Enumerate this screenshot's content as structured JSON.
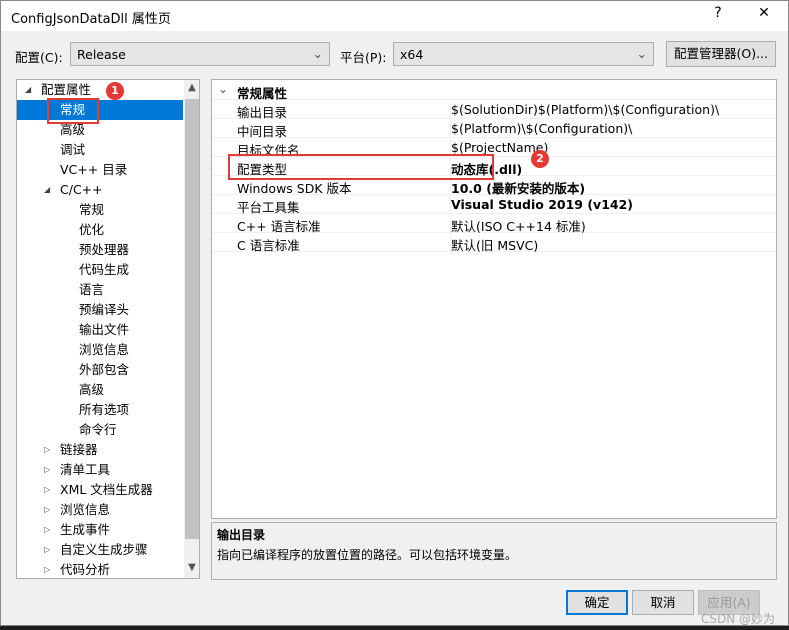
{
  "window": {
    "title": "ConfigJsonDataDll 属性页",
    "help": "?",
    "close": "✕"
  },
  "toolbar": {
    "config_label": "配置(C):",
    "config_value": "Release",
    "platform_label": "平台(P):",
    "platform_value": "x64",
    "manager_button": "配置管理器(O)..."
  },
  "tree": {
    "items": [
      {
        "label": "配置属性",
        "level": 0,
        "expanded": true
      },
      {
        "label": "常规",
        "level": 1,
        "selected": true
      },
      {
        "label": "高级",
        "level": 1
      },
      {
        "label": "调试",
        "level": 1
      },
      {
        "label": "VC++ 目录",
        "level": 1
      },
      {
        "label": "C/C++",
        "level": 1,
        "expanded": true
      },
      {
        "label": "常规",
        "level": 2
      },
      {
        "label": "优化",
        "level": 2
      },
      {
        "label": "预处理器",
        "level": 2
      },
      {
        "label": "代码生成",
        "level": 2
      },
      {
        "label": "语言",
        "level": 2
      },
      {
        "label": "预编译头",
        "level": 2
      },
      {
        "label": "输出文件",
        "level": 2
      },
      {
        "label": "浏览信息",
        "level": 2
      },
      {
        "label": "外部包含",
        "level": 2
      },
      {
        "label": "高级",
        "level": 2
      },
      {
        "label": "所有选项",
        "level": 2
      },
      {
        "label": "命令行",
        "level": 2
      },
      {
        "label": "链接器",
        "level": 1,
        "expanded": false
      },
      {
        "label": "清单工具",
        "level": 1,
        "expanded": false
      },
      {
        "label": "XML 文档生成器",
        "level": 1,
        "expanded": false
      },
      {
        "label": "浏览信息",
        "level": 1,
        "expanded": false
      },
      {
        "label": "生成事件",
        "level": 1,
        "expanded": false
      },
      {
        "label": "自定义生成步骤",
        "level": 1,
        "expanded": false
      },
      {
        "label": "代码分析",
        "level": 1,
        "expanded": false
      }
    ]
  },
  "grid": {
    "section": "常规属性",
    "rows": [
      {
        "name": "输出目录",
        "value": "$(SolutionDir)$(Platform)\\$(Configuration)\\",
        "bold": false
      },
      {
        "name": "中间目录",
        "value": "$(Platform)\\$(Configuration)\\",
        "bold": false
      },
      {
        "name": "目标文件名",
        "value": "$(ProjectName)",
        "bold": false
      },
      {
        "name": "配置类型",
        "value": "动态库(.dll)",
        "bold": true
      },
      {
        "name": "Windows SDK 版本",
        "value": "10.0 (最新安装的版本)",
        "bold": true
      },
      {
        "name": "平台工具集",
        "value": "Visual Studio 2019 (v142)",
        "bold": true
      },
      {
        "name": "C++ 语言标准",
        "value": "默认(ISO C++14 标准)",
        "bold": false
      },
      {
        "name": "C 语言标准",
        "value": "默认(旧 MSVC)",
        "bold": false
      }
    ]
  },
  "description": {
    "title": "输出目录",
    "text": "指向已编译程序的放置位置的路径。可以包括环境变量。"
  },
  "buttons": {
    "ok": "确定",
    "cancel": "取消",
    "apply": "应用(A)"
  },
  "annotations": {
    "badge1": "1",
    "badge2": "2",
    "color": "#e53935"
  },
  "watermark": "CSDN @妙为"
}
